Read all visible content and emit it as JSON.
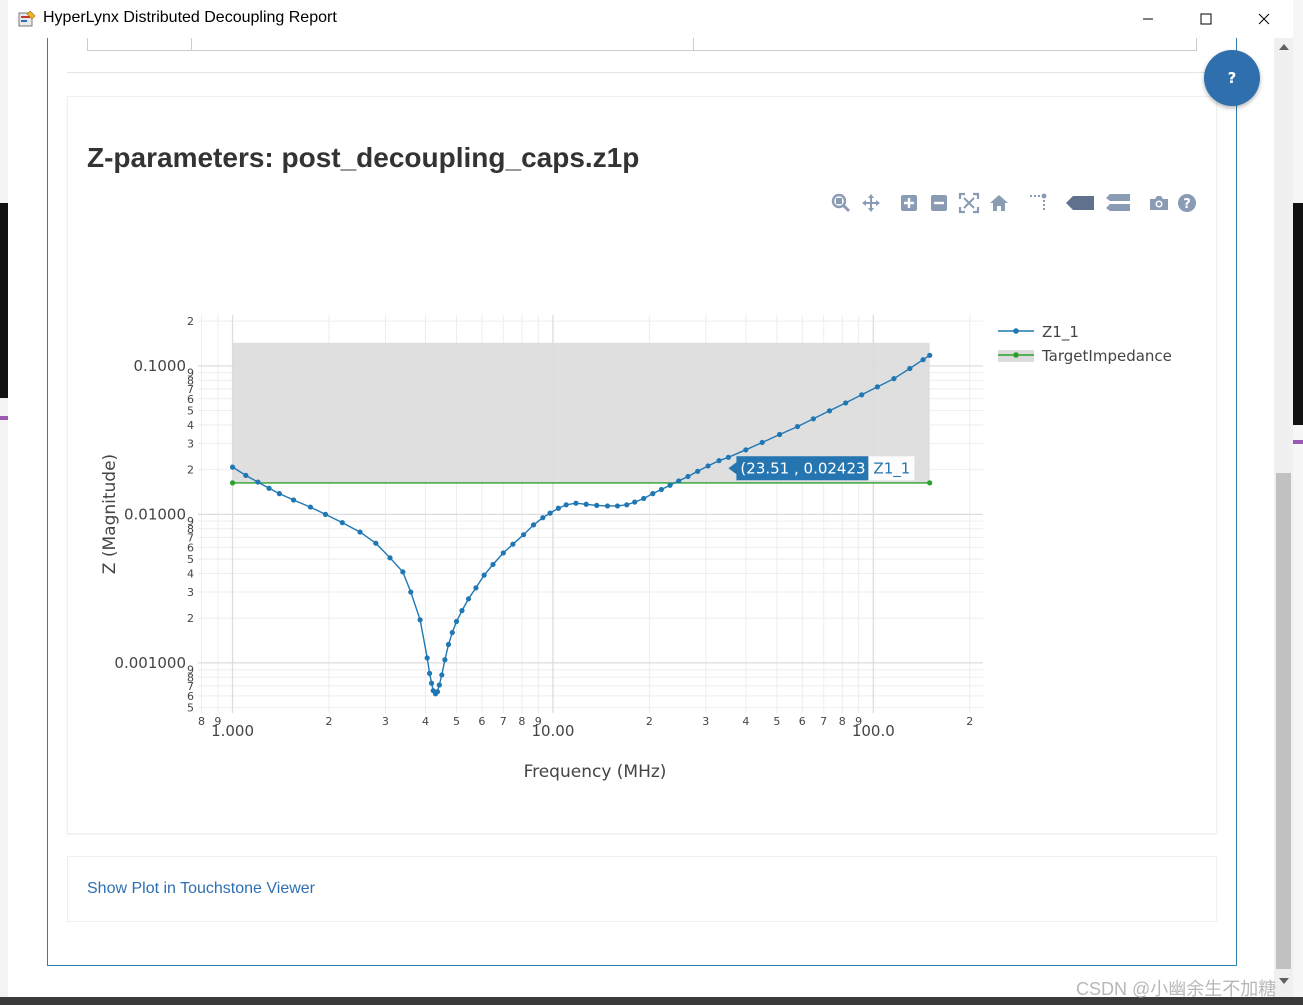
{
  "window": {
    "title": "HyperLynx Distributed Decoupling Report",
    "controls": [
      "minimize",
      "maximize",
      "close"
    ]
  },
  "plot": {
    "title": "Z-parameters: post_decoupling_caps.z1p",
    "modebar": [
      "zoom-icon",
      "pan-icon",
      "zoom-in-icon",
      "zoom-out-icon",
      "autoscale-icon",
      "reset-axes-icon",
      "spike-lines-icon",
      "hover-closest-icon",
      "hover-compare-icon",
      "camera-icon",
      "help-icon"
    ],
    "tooltip": {
      "coords": "(23.51 , 0.02423 )",
      "series": "Z1_1"
    }
  },
  "links": {
    "touchstone": "Show Plot in Touchstone Viewer"
  },
  "help_button": {
    "label": "?"
  },
  "watermark": "CSDN @小幽余生不加糖",
  "colors": {
    "series_z": "#1f77b4",
    "series_target": "#2ca02c",
    "band": "#dcdcdc",
    "link": "#2f6fb0",
    "accent": "#2f6fae"
  },
  "chart_data": {
    "type": "line",
    "xlabel": "Frequency (MHz)",
    "ylabel": "Z (Magnitude)",
    "xscale": "log",
    "yscale": "log",
    "xlim": [
      0.78,
      220
    ],
    "ylim": [
      0.00046,
      0.22
    ],
    "x_ticks_major": [
      {
        "v": 1,
        "label": "1.000"
      },
      {
        "v": 10,
        "label": "10.00"
      },
      {
        "v": 100,
        "label": "100.0"
      }
    ],
    "x_ticks_minor": [
      {
        "v": 0.8,
        "label": "8"
      },
      {
        "v": 0.9,
        "label": "9"
      },
      {
        "v": 2,
        "label": "2"
      },
      {
        "v": 3,
        "label": "3"
      },
      {
        "v": 4,
        "label": "4"
      },
      {
        "v": 5,
        "label": "5"
      },
      {
        "v": 6,
        "label": "6"
      },
      {
        "v": 7,
        "label": "7"
      },
      {
        "v": 8,
        "label": "8"
      },
      {
        "v": 9,
        "label": "9"
      },
      {
        "v": 20,
        "label": "2"
      },
      {
        "v": 30,
        "label": "3"
      },
      {
        "v": 40,
        "label": "4"
      },
      {
        "v": 50,
        "label": "5"
      },
      {
        "v": 60,
        "label": "6"
      },
      {
        "v": 70,
        "label": "7"
      },
      {
        "v": 80,
        "label": "8"
      },
      {
        "v": 90,
        "label": "9"
      },
      {
        "v": 200,
        "label": "2"
      }
    ],
    "y_ticks_major": [
      {
        "v": 0.1,
        "label": "0.1000"
      },
      {
        "v": 0.01,
        "label": "0.01000"
      },
      {
        "v": 0.001,
        "label": "0.001000"
      }
    ],
    "y_ticks_minor": [
      {
        "v": 0.2,
        "label": "2"
      },
      {
        "v": 0.09,
        "label": "9"
      },
      {
        "v": 0.08,
        "label": "8"
      },
      {
        "v": 0.07,
        "label": "7"
      },
      {
        "v": 0.06,
        "label": "6"
      },
      {
        "v": 0.05,
        "label": "5"
      },
      {
        "v": 0.04,
        "label": "4"
      },
      {
        "v": 0.03,
        "label": "3"
      },
      {
        "v": 0.02,
        "label": "2"
      },
      {
        "v": 0.009,
        "label": "9"
      },
      {
        "v": 0.008,
        "label": "8"
      },
      {
        "v": 0.007,
        "label": "7"
      },
      {
        "v": 0.006,
        "label": "6"
      },
      {
        "v": 0.005,
        "label": "5"
      },
      {
        "v": 0.004,
        "label": "4"
      },
      {
        "v": 0.003,
        "label": "3"
      },
      {
        "v": 0.002,
        "label": "2"
      },
      {
        "v": 0.0009,
        "label": "9"
      },
      {
        "v": 0.0008,
        "label": "8"
      },
      {
        "v": 0.0007,
        "label": "7"
      },
      {
        "v": 0.0006,
        "label": "6"
      },
      {
        "v": 0.0005,
        "label": "5"
      }
    ],
    "band": {
      "x": [
        1,
        150
      ],
      "y": [
        0.0163,
        0.143
      ]
    },
    "series": [
      {
        "name": "Z1_1",
        "color": "#1f77b4",
        "points": [
          [
            1.0,
            0.0208
          ],
          [
            1.1,
            0.0183
          ],
          [
            1.2,
            0.0165
          ],
          [
            1.3,
            0.015
          ],
          [
            1.4,
            0.0138
          ],
          [
            1.55,
            0.0125
          ],
          [
            1.75,
            0.0112
          ],
          [
            1.95,
            0.01
          ],
          [
            2.2,
            0.0088
          ],
          [
            2.5,
            0.0076
          ],
          [
            2.8,
            0.0064
          ],
          [
            3.1,
            0.0051
          ],
          [
            3.4,
            0.0041
          ],
          [
            3.6,
            0.003
          ],
          [
            3.85,
            0.00195
          ],
          [
            4.05,
            0.00108
          ],
          [
            4.12,
            0.00085
          ],
          [
            4.18,
            0.00073
          ],
          [
            4.23,
            0.00065
          ],
          [
            4.3,
            0.00062
          ],
          [
            4.36,
            0.00064
          ],
          [
            4.42,
            0.00071
          ],
          [
            4.5,
            0.00083
          ],
          [
            4.6,
            0.00105
          ],
          [
            4.72,
            0.00133
          ],
          [
            4.85,
            0.0016
          ],
          [
            5.0,
            0.0019
          ],
          [
            5.2,
            0.00225
          ],
          [
            5.45,
            0.0027
          ],
          [
            5.75,
            0.0032
          ],
          [
            6.1,
            0.0039
          ],
          [
            6.5,
            0.0046
          ],
          [
            7.0,
            0.0055
          ],
          [
            7.5,
            0.0063
          ],
          [
            8.1,
            0.0073
          ],
          [
            8.7,
            0.0085
          ],
          [
            9.3,
            0.0095
          ],
          [
            9.8,
            0.0102
          ],
          [
            10.4,
            0.011
          ],
          [
            11.0,
            0.0116
          ],
          [
            11.8,
            0.0119
          ],
          [
            12.7,
            0.0117
          ],
          [
            13.7,
            0.0115
          ],
          [
            14.8,
            0.0114
          ],
          [
            15.9,
            0.0114
          ],
          [
            17.0,
            0.0116
          ],
          [
            18.0,
            0.0121
          ],
          [
            19.2,
            0.0128
          ],
          [
            20.5,
            0.0138
          ],
          [
            21.8,
            0.0147
          ],
          [
            23.2,
            0.0157
          ],
          [
            24.7,
            0.0168
          ],
          [
            26.4,
            0.018
          ],
          [
            28.3,
            0.0195
          ],
          [
            30.5,
            0.0212
          ],
          [
            33.0,
            0.023
          ],
          [
            35.3,
            0.02423
          ],
          [
            40.0,
            0.0272
          ],
          [
            45.0,
            0.0305
          ],
          [
            51.0,
            0.0345
          ],
          [
            58.0,
            0.039
          ],
          [
            65.0,
            0.044
          ],
          [
            73.0,
            0.0498
          ],
          [
            82.0,
            0.0563
          ],
          [
            92.0,
            0.0638
          ],
          [
            103.0,
            0.0722
          ],
          [
            116.0,
            0.082
          ],
          [
            130.0,
            0.096
          ],
          [
            143.0,
            0.11
          ],
          [
            150.0,
            0.1178
          ]
        ]
      },
      {
        "name": "TargetImpedance",
        "color": "#2ca02c",
        "points": [
          [
            1.0,
            0.0163
          ],
          [
            150.0,
            0.0163
          ]
        ]
      }
    ]
  }
}
